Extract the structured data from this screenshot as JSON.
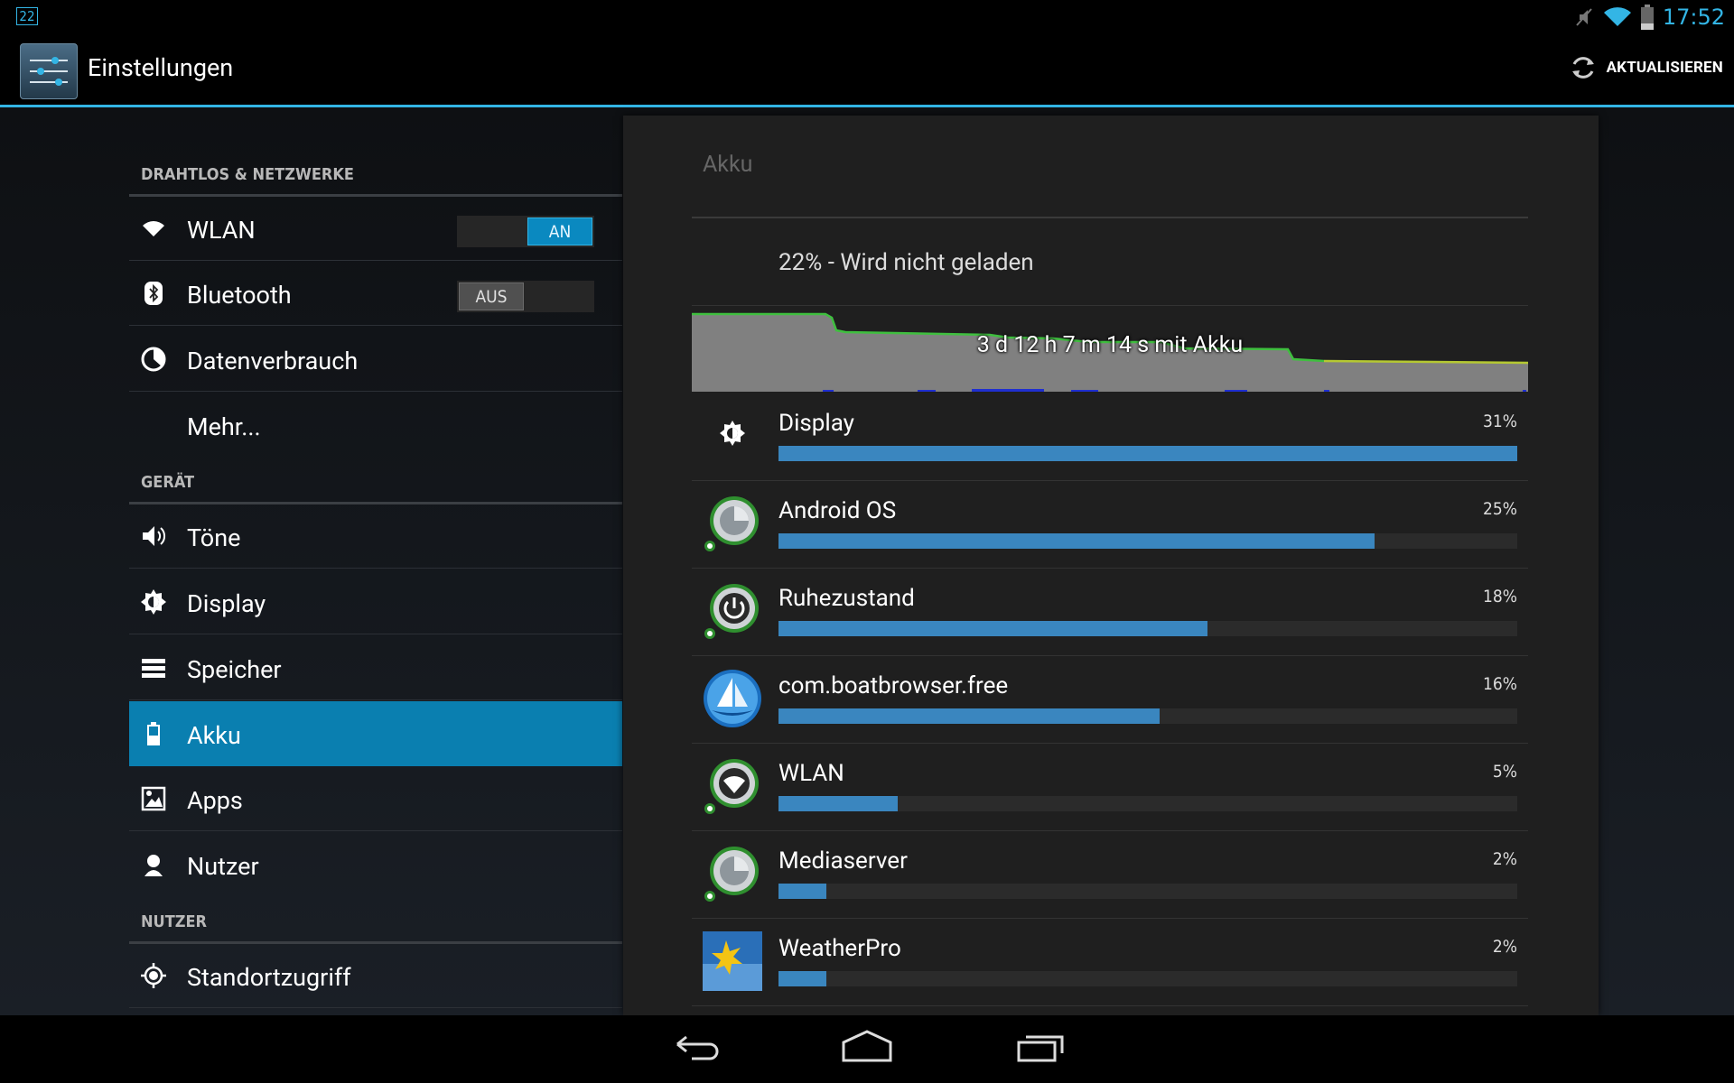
{
  "status_bar": {
    "notification_badge": "22",
    "time": "17:52"
  },
  "action_bar": {
    "title": "Einstellungen",
    "refresh_label": "AKTUALISIEREN"
  },
  "settings": {
    "sections": [
      {
        "header": "DRAHTLOS & NETZWERKE"
      },
      {
        "header": "GERÄT"
      },
      {
        "header": "NUTZER"
      }
    ],
    "items": [
      {
        "label": "WLAN",
        "icon": "wifi-icon",
        "toggle": "AN"
      },
      {
        "label": "Bluetooth",
        "icon": "bluetooth-icon",
        "toggle": "AUS"
      },
      {
        "label": "Datenverbrauch",
        "icon": "data-usage-icon"
      },
      {
        "label": "Mehr..."
      },
      {
        "label": "Töne",
        "icon": "speaker-icon"
      },
      {
        "label": "Display",
        "icon": "brightness-icon"
      },
      {
        "label": "Speicher",
        "icon": "storage-icon"
      },
      {
        "label": "Akku",
        "icon": "battery-icon",
        "selected": true
      },
      {
        "label": "Apps",
        "icon": "apps-icon"
      },
      {
        "label": "Nutzer",
        "icon": "user-icon"
      },
      {
        "label": "Standortzugriff",
        "icon": "location-icon"
      }
    ]
  },
  "battery": {
    "title": "Akku",
    "status": "22% - Wird nicht geladen",
    "chart_label": "3 d 12 h 7 m 14 s mit Akku",
    "level_percent": 22,
    "usage": [
      {
        "name": "Display",
        "percent": 31,
        "percent_label": "31%",
        "icon": "brightness-icon"
      },
      {
        "name": "Android OS",
        "percent": 25,
        "percent_label": "25%",
        "icon": "android-os-icon"
      },
      {
        "name": "Ruhezustand",
        "percent": 18,
        "percent_label": "18%",
        "icon": "power-icon"
      },
      {
        "name": "com.boatbrowser.free",
        "percent": 16,
        "percent_label": "16%",
        "icon": "boat-browser-icon"
      },
      {
        "name": "WLAN",
        "percent": 5,
        "percent_label": "5%",
        "icon": "wifi-app-icon"
      },
      {
        "name": "Mediaserver",
        "percent": 2,
        "percent_label": "2%",
        "icon": "mediaserver-icon"
      },
      {
        "name": "WeatherPro",
        "percent": 2,
        "percent_label": "2%",
        "icon": "weatherpro-icon"
      }
    ]
  },
  "colors": {
    "accent": "#33b5e5",
    "selected": "#0a7fb0",
    "bar": "#3a86bf"
  }
}
